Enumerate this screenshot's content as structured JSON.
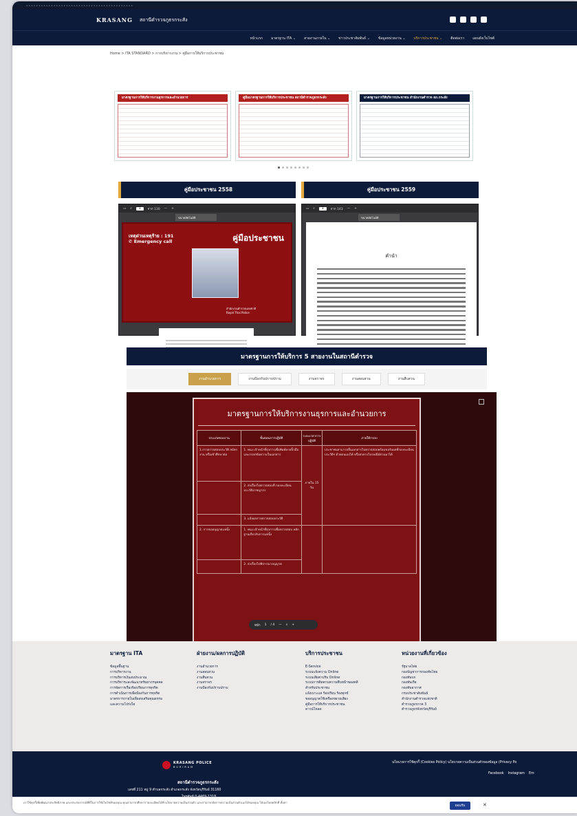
{
  "os_bar": {
    "text": "• • • • • • • • • • • • • • • • • • • • • • • • • • • • • • • • • • • • • • • • • • •"
  },
  "site": {
    "logo": "KRASANG",
    "title": "สถานีตำรวจภูธรกระสัง"
  },
  "nav": {
    "items": [
      "หน้าแรก",
      "มาตรฐาน ITA ⌄",
      "สายงานภายใน ⌄",
      "ข่าวประชาสัมพันธ์ ⌄",
      "ข้อมูลหน่วยงาน ⌄",
      "บริการประชาชน ⌄",
      "ติดต่อเรา",
      "แผนผังเว็บไซต์"
    ],
    "active_index": 5
  },
  "breadcrumb": "Home > ITA STANDARD > การบริหารงาน > คู่มือการให้บริการประชาชน",
  "banner": {
    "slides": [
      {
        "title": "มาตรฐานการให้บริการงานธุรการและอำนวยการ"
      },
      {
        "title": "คู่มือมาตรฐานการให้บริการประชาชน สถานีตำรวจภูธรกระสัง"
      },
      {
        "title": "มาตรฐานการให้บริการประชาชน สำนักงานตำรวจ สภ.กระสัง"
      }
    ],
    "dot_count": 8,
    "active_dot": 0
  },
  "manuals": [
    {
      "heading": "คู่มือประชาชน 2558",
      "page_input": "1",
      "page_total": "จาก 130",
      "zoom_label": "ขนาดอัตโนมัติ",
      "cover": {
        "emergency": "เหตุด่วนเหตุร้าย : 191\n✆ Emergency call",
        "title": "คู่มือประชาชน",
        "footer": "สำนักงานตำรวจแห่งชาติ\nRoyal Thai Police"
      }
    },
    {
      "heading": "คู่มือประชาชน 2559",
      "page_input": "1",
      "page_total": "จาก 143",
      "zoom_label": "ขนาดอัตโนมัติ",
      "doc": {
        "title": "คำนำ"
      }
    }
  ],
  "services": {
    "heading": "มาตรฐานการให้บริการ 5 สายงานในสถานีตำรวจ",
    "tabs": [
      "งานอำนวยการ",
      "งานป้องกันปราบปราม",
      "งานจราจร",
      "งานสอบสวน",
      "งานสืบสวน"
    ],
    "selected_tab": 0,
    "standard_title": "มาตรฐานการให้บริการงานธุรการและอำนวยการ",
    "table_headers": [
      "ประเภทของงาน",
      "ขั้นตอนการปฏิบัติ",
      "ระยะเวลาการปฏิบัติ",
      "ภายใต้กรอบ"
    ],
    "rows": [
      [
        "1.การตรวจสอบประวัติ สมัครงาน หรือเข้าศึกษาต่อ",
        "1. พนง.เจ้าหน้าที่ธุรการเพื่อพิมพ์ลายนิ้วมือ และกรอกข้อความในเอกสาร",
        "ภายใน 15 วัน",
        "ประชาชนสามารถยื่นเอกสารไปตรวจสอบพร้อมขอรับผลที่กองทะเบียนประวัติฯ ด้วยตนเองได้ หรือส่งทางไปรษณีย์ด่วนมาได้"
      ],
      [
        "",
        "2. ส่งเรื่องไปตรวจสอบที่ กองทะเบียน ประวัติอาชญากร",
        "",
        ""
      ],
      [
        "",
        "3. แจ้งผลการตรวจสอบประวัติ",
        "",
        ""
      ],
      [
        "2. การขออนุญาตแห่นั้ง",
        "1. พนง.เจ้าหน้าที่ธุรการเพื่อตรวจสอบ หลักฐานเกี่ยวกับการแห่นั้ง",
        "",
        ""
      ],
      [
        "",
        "2. ส่งเรื่องไปพิจารณาอนุญาต",
        "",
        ""
      ]
    ],
    "pdf_page_label": "หน้า",
    "pdf_page": "1",
    "pdf_total": "/ 4",
    "pdf_zoom_out": "—",
    "pdf_zoom_in": "+"
  },
  "footer": {
    "columns": [
      {
        "title": "มาตรฐาน ITA",
        "items": [
          "ข้อมูลพื้นฐาน",
          "การบริหารงาน",
          "การบริหารเงินงบประมาณ",
          "การบริหารและพัฒนาทรัพยากรบุคคล",
          "การจัดการเรื่องร้องเรียนการทุจริต",
          "การดำเนินการเพื่อป้องกันการทุจริต",
          "มาตรการภายในเพื่อส่งเสริมคุณธรรม",
          "และความโปร่งใส"
        ]
      },
      {
        "title": "ฝ่ายงาน/ผลการปฏิบัติ",
        "items": [
          "งานอำนวยการ",
          "งานสอบสวน",
          "งานสืบสวน",
          "งานจราจร",
          "งานป้องกันปราบปราม"
        ]
      },
      {
        "title": "บริการประชาชน",
        "items": [
          "E-Service",
          "ระบบแจ้งความ Online",
          "ระบบเสียค่าปรับ Online",
          "ระบบการติดตามความคืบหน้าของคดี",
          "สำหรับประชาชน",
          "แจ้งเบาะแส ร้องเรียน ร้องทุกข์",
          "ขออนุญาตใช้เครื่องขยายเสียง",
          "คู่มือการให้บริการประชาชน",
          "ดาวน์โหลด"
        ]
      },
      {
        "title": "หน่วยงานที่เกี่ยวข้อง",
        "items": [
          "รัฐบาลไทย",
          "กองบัญชาการกองทัพไทย",
          "กองทัพบก",
          "กองทัพเรือ",
          "กองทัพอากาศ",
          "กรมประชาสัมพันธ์",
          "สำนักงานตำรวจแห่งชาติ",
          "ตำรวจภูธรภาค 3",
          "ตำรวจภูธรจังหวัดบุรีรัมย์"
        ]
      }
    ],
    "brand_name": "KRASANG POLICE",
    "brand_sub": "BURIRAM",
    "station": "สถานีตำรวจภูธรกระสัง",
    "address": "เลขที่ 211 หมู่ 9 ตำบลกระสัง อำเภอกระสัง จังหวัดบุรีรัมย์ 31160",
    "phone": "โทรศัพท์ 0-4469-1318",
    "policy": "นโยบายการใช้คุกกี้ (Cookies Policy)   นโยบายความเป็นส่วนตัวของข้อมูล (Privacy Po",
    "social": [
      "Facebook",
      "Instagram",
      "Em"
    ]
  },
  "cookie": {
    "text": "เราใช้คุกกี้เพื่อพัฒนาประสิทธิภาพ และประสบการณ์ที่ดีในการใช้เว็บไซต์ของคุณ คุณสามารถศึกษารายละเอียดได้ที่ นโยบายความเป็นส่วนตัว และสามารถจัดการความเป็นส่วนตัวเองได้ของคุณ ได้เองโดยคลิกที่ ตั้งค่า",
    "accept": "ยอมรับ",
    "close": "✕"
  }
}
